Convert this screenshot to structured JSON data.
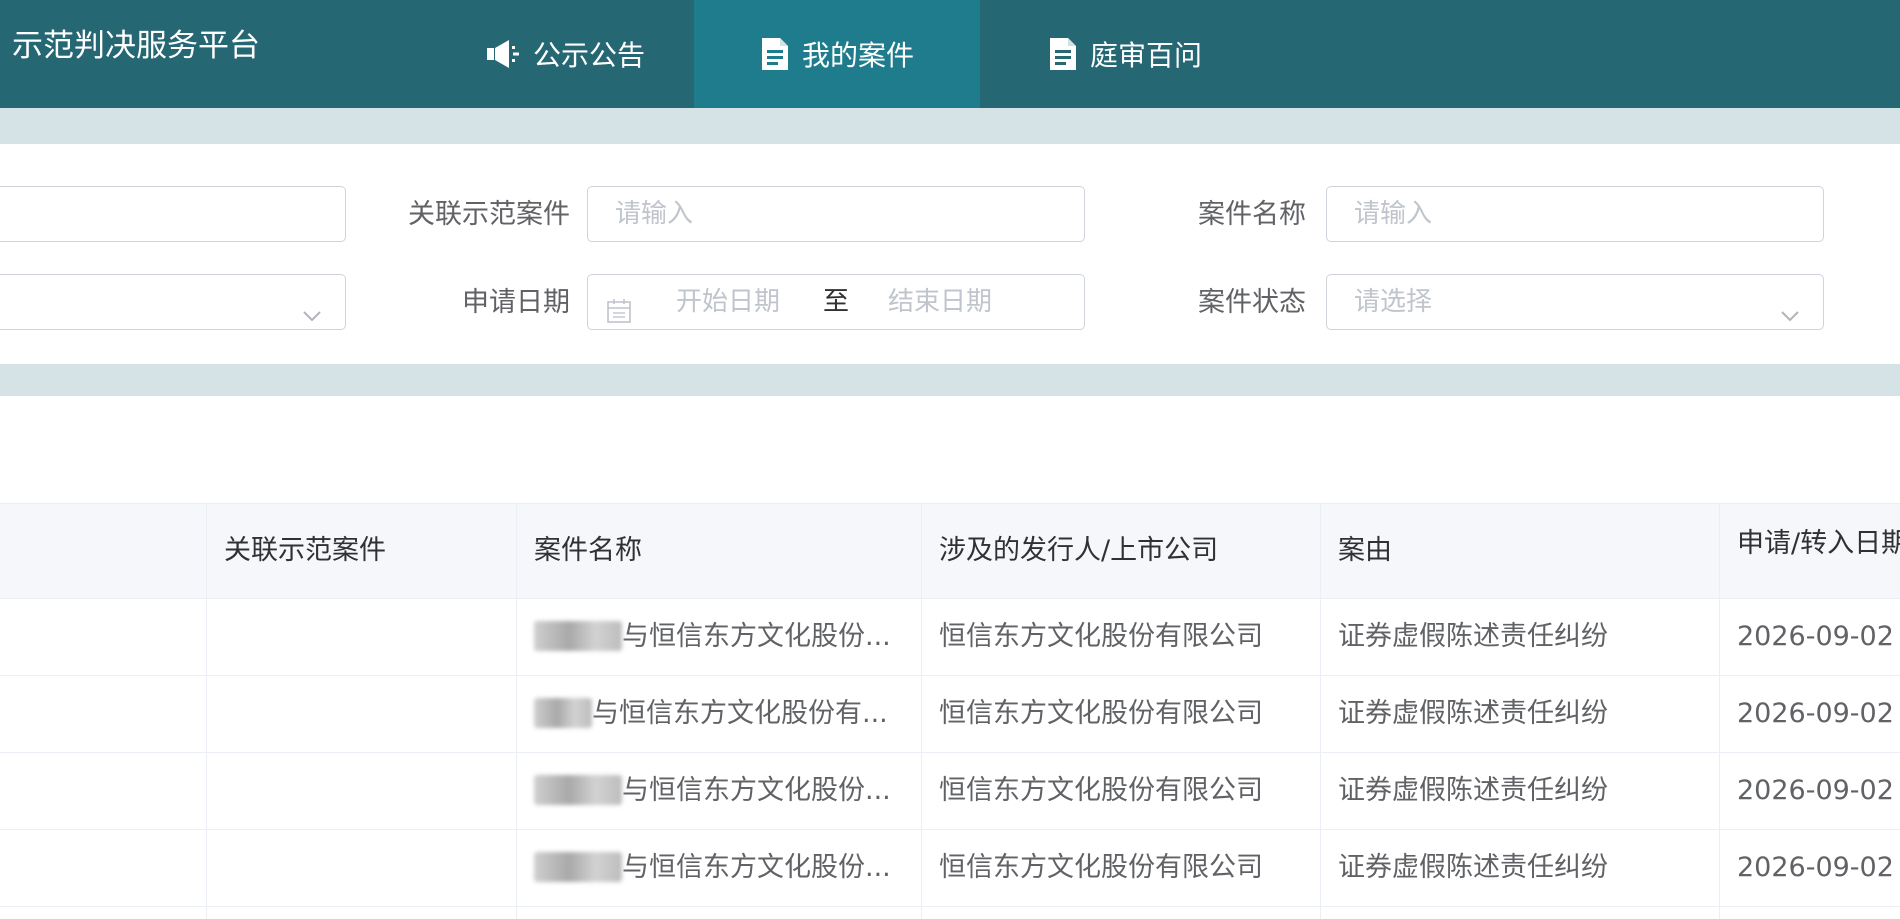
{
  "app": {
    "title": "示范判决服务平台"
  },
  "nav": {
    "tabs": [
      {
        "label": "公示公告",
        "icon": "megaphone-icon",
        "active": false
      },
      {
        "label": "我的案件",
        "icon": "document-icon",
        "active": true
      },
      {
        "label": "庭审百问",
        "icon": "document-icon",
        "active": false
      }
    ]
  },
  "filters": {
    "linked_case": {
      "label": "关联示范案件",
      "placeholder": "请输入"
    },
    "case_name": {
      "label": "案件名称",
      "placeholder": "请输入"
    },
    "apply_date": {
      "label": "申请日期",
      "start_placeholder": "开始日期",
      "separator": "至",
      "end_placeholder": "结束日期"
    },
    "case_status": {
      "label": "案件状态",
      "placeholder": "请选择"
    }
  },
  "table": {
    "columns": [
      "关联示范案件",
      "案件名称",
      "涉及的发行人/上市公司",
      "案由",
      "申请/转入日期"
    ],
    "rows": [
      {
        "linked_case": "",
        "case_name": "与恒信东方文化股份...",
        "company": "恒信东方文化股份有限公司",
        "cause": "证券虚假陈述责任纠纷",
        "date": "2026-09-02"
      },
      {
        "linked_case": "",
        "case_name": "与恒信东方文化股份有...",
        "company": "恒信东方文化股份有限公司",
        "cause": "证券虚假陈述责任纠纷",
        "date": "2026-09-02"
      },
      {
        "linked_case": "",
        "case_name": "与恒信东方文化股份...",
        "company": "恒信东方文化股份有限公司",
        "cause": "证券虚假陈述责任纠纷",
        "date": "2026-09-02"
      },
      {
        "linked_case": "",
        "case_name": "与恒信东方文化股份...",
        "company": "恒信东方文化股份有限公司",
        "cause": "证券虚假陈述责任纠纷",
        "date": "2026-09-02"
      }
    ]
  },
  "colors": {
    "nav_bg": "#256773",
    "nav_active": "#1e7c8c",
    "band": "#d5e3e6"
  }
}
